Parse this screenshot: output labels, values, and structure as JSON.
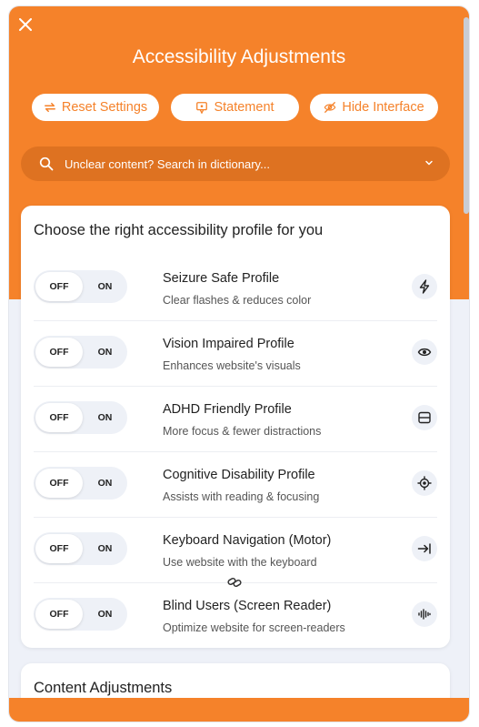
{
  "header": {
    "title": "Accessibility Adjustments",
    "buttons": [
      {
        "label": "Reset Settings",
        "icon": "reset-icon"
      },
      {
        "label": "Statement",
        "icon": "statement-icon"
      },
      {
        "label": "Hide Interface",
        "icon": "eye-slash-icon"
      }
    ],
    "search_placeholder": "Unclear content? Search in dictionary...",
    "accent": "#f5822a"
  },
  "profiles": {
    "title": "Choose the right accessibility profile for you",
    "toggle_off": "OFF",
    "toggle_on": "ON",
    "items": [
      {
        "name": "Seizure Safe Profile",
        "desc": "Clear flashes & reduces color",
        "icon": "lightning-icon"
      },
      {
        "name": "Vision Impaired Profile",
        "desc": "Enhances website's visuals",
        "icon": "eye-icon"
      },
      {
        "name": "ADHD Friendly Profile",
        "desc": "More focus & fewer distractions",
        "icon": "focus-panel-icon"
      },
      {
        "name": "Cognitive Disability Profile",
        "desc": "Assists with reading & focusing",
        "icon": "target-icon"
      },
      {
        "name": "Keyboard Navigation (Motor)",
        "desc": "Use website with the keyboard",
        "icon": "arrow-to-line-icon"
      },
      {
        "name": "Blind Users (Screen Reader)",
        "desc": "Optimize website for screen-readers",
        "icon": "audio-wave-icon"
      }
    ]
  },
  "content_adjustments": {
    "title": "Content Adjustments"
  }
}
